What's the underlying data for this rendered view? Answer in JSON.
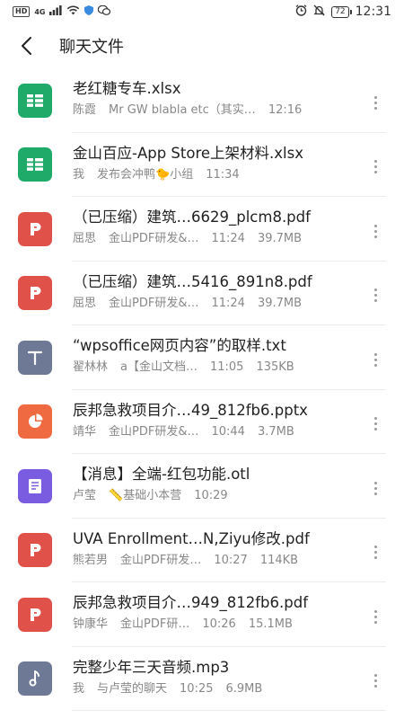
{
  "status_bar": {
    "hd": "HD",
    "signal": "4G",
    "battery": "72",
    "time": "12:31"
  },
  "header": {
    "title": "聊天文件"
  },
  "files": [
    {
      "name": "老红糖专车.xlsx",
      "icon": "xlsx",
      "sender": "陈霞",
      "source": "Mr GW blabla etc（其实…",
      "time": "12:16",
      "size": ""
    },
    {
      "name": "金山百应-App Store上架材料.xlsx",
      "icon": "xlsx",
      "sender": "我",
      "source": "发布会冲鸭🐤小组",
      "time": "11:34",
      "size": ""
    },
    {
      "name": "（已压缩）建筑…6629_plcm8.pdf",
      "icon": "pdf",
      "sender": "屈思",
      "source": "金山PDF研发&…",
      "time": "11:24",
      "size": "39.7MB"
    },
    {
      "name": "（已压缩）建筑…5416_891n8.pdf",
      "icon": "pdf",
      "sender": "屈思",
      "source": "金山PDF研发&…",
      "time": "11:24",
      "size": "39.7MB"
    },
    {
      "name": "“wpsoffice网页内容”的取样.txt",
      "icon": "txt",
      "sender": "翟林林",
      "source": "a【金山文档…",
      "time": "11:05",
      "size": "135KB"
    },
    {
      "name": "辰邦急救项目介…49_812fb6.pptx",
      "icon": "pptx",
      "sender": "靖华",
      "source": "金山PDF研发&…",
      "time": "10:44",
      "size": "3.7MB"
    },
    {
      "name": "【消息】全端-红包功能.otl",
      "icon": "otl",
      "sender": "卢莹",
      "source": "📏基础小本营",
      "time": "10:29",
      "size": ""
    },
    {
      "name": "UVA Enrollment…N,Ziyu修改.pdf",
      "icon": "pdf",
      "sender": "熊若男",
      "source": "金山PDF研发…",
      "time": "10:27",
      "size": "114KB"
    },
    {
      "name": "辰邦急救项目介…949_812fb6.pdf",
      "icon": "pdf",
      "sender": "钟康华",
      "source": "金山PDF研…",
      "time": "10:26",
      "size": "15.1MB"
    },
    {
      "name": "完整少年三天音频.mp3",
      "icon": "mp3",
      "sender": "我",
      "source": "与卢莹的聊天",
      "time": "10:25",
      "size": "6.9MB"
    }
  ],
  "colors": {
    "xlsx": "#1faa6a",
    "pdf": "#e0514a",
    "txt": "#6e7a95",
    "pptx": "#ef6a41",
    "otl": "#7a5ce0",
    "mp3": "#6e7a95"
  }
}
